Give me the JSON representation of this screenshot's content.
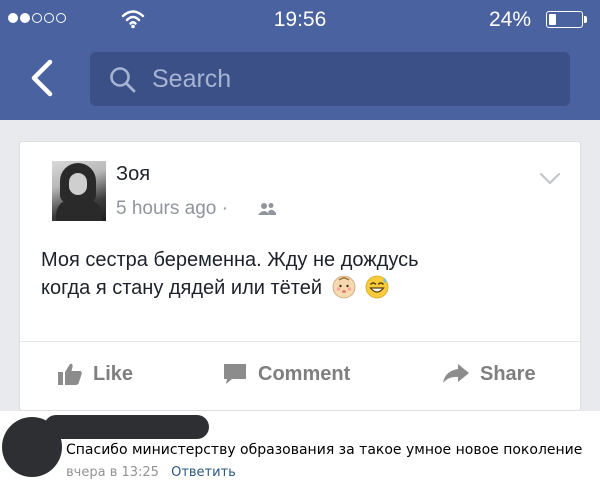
{
  "status_bar": {
    "time": "19:56",
    "battery": "24%",
    "battery_level": 0.24,
    "signal_bars_filled": 2,
    "signal_bars_total": 5
  },
  "header": {
    "back_icon": "back-chevron-icon",
    "search": {
      "placeholder": "Search",
      "icon": "search-icon"
    },
    "color": "#4a63a0"
  },
  "post": {
    "author": "Зоя",
    "time": "5 hours ago ·",
    "audience_icon": "friends-icon",
    "text_line1": "Моя сестра беременна. Жду не дождусь",
    "text_line2": "когда я стану дядей или тётей",
    "emoji": [
      "baby-face-icon",
      "grinning-sweat-icon"
    ],
    "actions": {
      "like": "Like",
      "comment": "Comment",
      "share": "Share"
    }
  },
  "comment": {
    "text": "Спасибо министерству образования за такое умное новое поколение",
    "time": "вчера в 13:25",
    "reply": "Ответить"
  }
}
